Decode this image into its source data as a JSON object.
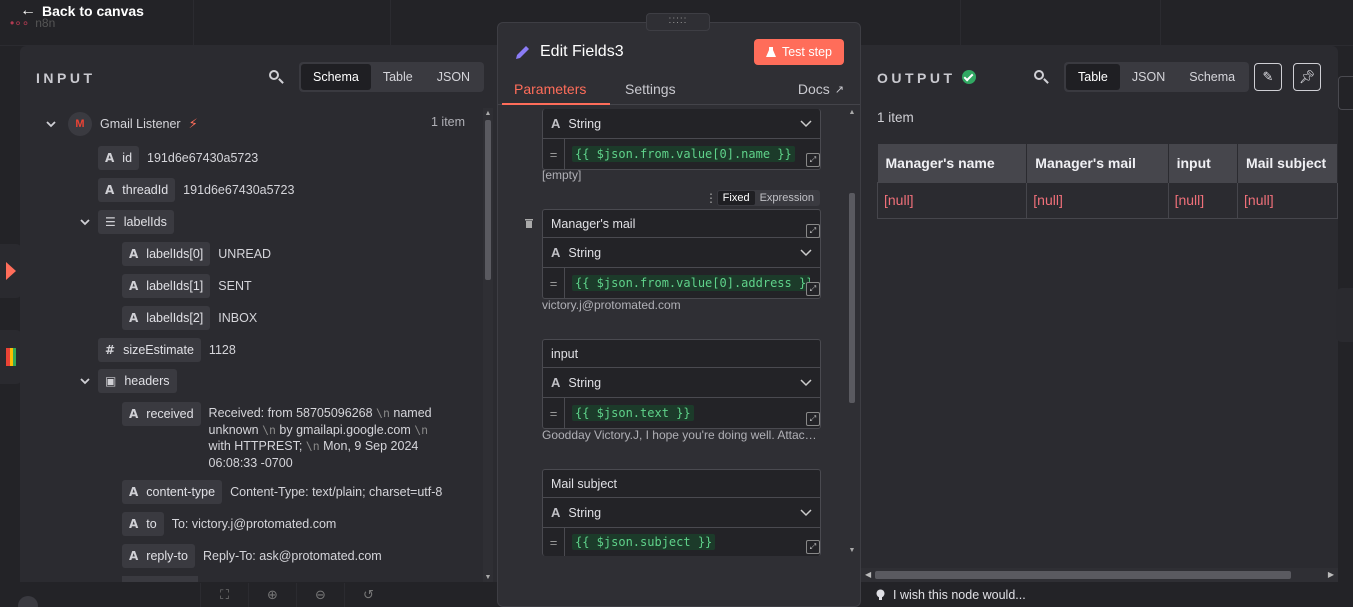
{
  "header": {
    "back_label": "Back to canvas",
    "logo_text": "n8n"
  },
  "input": {
    "title": "INPUT",
    "views": [
      "Schema",
      "Table",
      "JSON"
    ],
    "active_view": "Schema",
    "node_name": "Gmail Listener",
    "item_count": "1 item",
    "fields": [
      {
        "key": "id",
        "type": "A",
        "value": "191d6e67430a5723"
      },
      {
        "key": "threadId",
        "type": "A",
        "value": "191d6e67430a5723"
      },
      {
        "key": "labelIds",
        "type": "list"
      },
      {
        "key": "labelIds[0]",
        "type": "A",
        "value": "UNREAD"
      },
      {
        "key": "labelIds[1]",
        "type": "A",
        "value": "SENT"
      },
      {
        "key": "labelIds[2]",
        "type": "A",
        "value": "INBOX"
      },
      {
        "key": "sizeEstimate",
        "type": "#",
        "value": "1128"
      },
      {
        "key": "headers",
        "type": "object"
      },
      {
        "key": "received",
        "type": "A",
        "value_lines": [
          "Received: from 58705096268",
          "named",
          "unknown",
          "by gmailapi.google.com",
          "with HTTPREST;",
          "Mon, 9 Sep 2024",
          "06:08:33 -0700"
        ],
        "newline": "\\n"
      },
      {
        "key": "content-type",
        "type": "A",
        "value": "Content-Type: text/plain; charset=utf-8"
      },
      {
        "key": "to",
        "type": "A",
        "value": "To: victory.j@protomated.com"
      },
      {
        "key": "reply-to",
        "type": "A",
        "value": "Reply-To: ask@protomated.com"
      }
    ]
  },
  "edit": {
    "title": "Edit Fields3",
    "test_label": "Test step",
    "tabs": [
      "Parameters",
      "Settings"
    ],
    "docs_label": "Docs",
    "mode_toggle": [
      "Fixed",
      "Expression"
    ],
    "assignments": [
      {
        "name": "",
        "type": "String",
        "expr": "{{ $json.from.value[0].name }}",
        "hint": "[empty]"
      },
      {
        "name": "Manager's mail",
        "type": "String",
        "expr": "{{ $json.from.value[0].address }}",
        "hint": "victory.j@protomated.com"
      },
      {
        "name": "input",
        "type": "String",
        "expr": "{{ $json.text }}",
        "hint": "Goodday Victory.J, I hope you're doing well. Attached is..."
      },
      {
        "name": "Mail subject",
        "type": "String",
        "expr": "{{ $json.subject }}",
        "hint": ""
      }
    ]
  },
  "output": {
    "title": "OUTPUT",
    "views": [
      "Table",
      "JSON",
      "Schema"
    ],
    "active_view": "Table",
    "item_count": "1 item",
    "columns": [
      "Manager's name",
      "Manager's mail",
      "input",
      "Mail subject"
    ],
    "rows": [
      [
        "[null]",
        "[null]",
        "[null]",
        "[null]"
      ]
    ]
  },
  "feedback": "I wish this node would...",
  "colors": {
    "accent": "#ff6d5a",
    "success": "#31a862",
    "null_text": "#f0707a",
    "expr_text": "#5fd28a"
  }
}
